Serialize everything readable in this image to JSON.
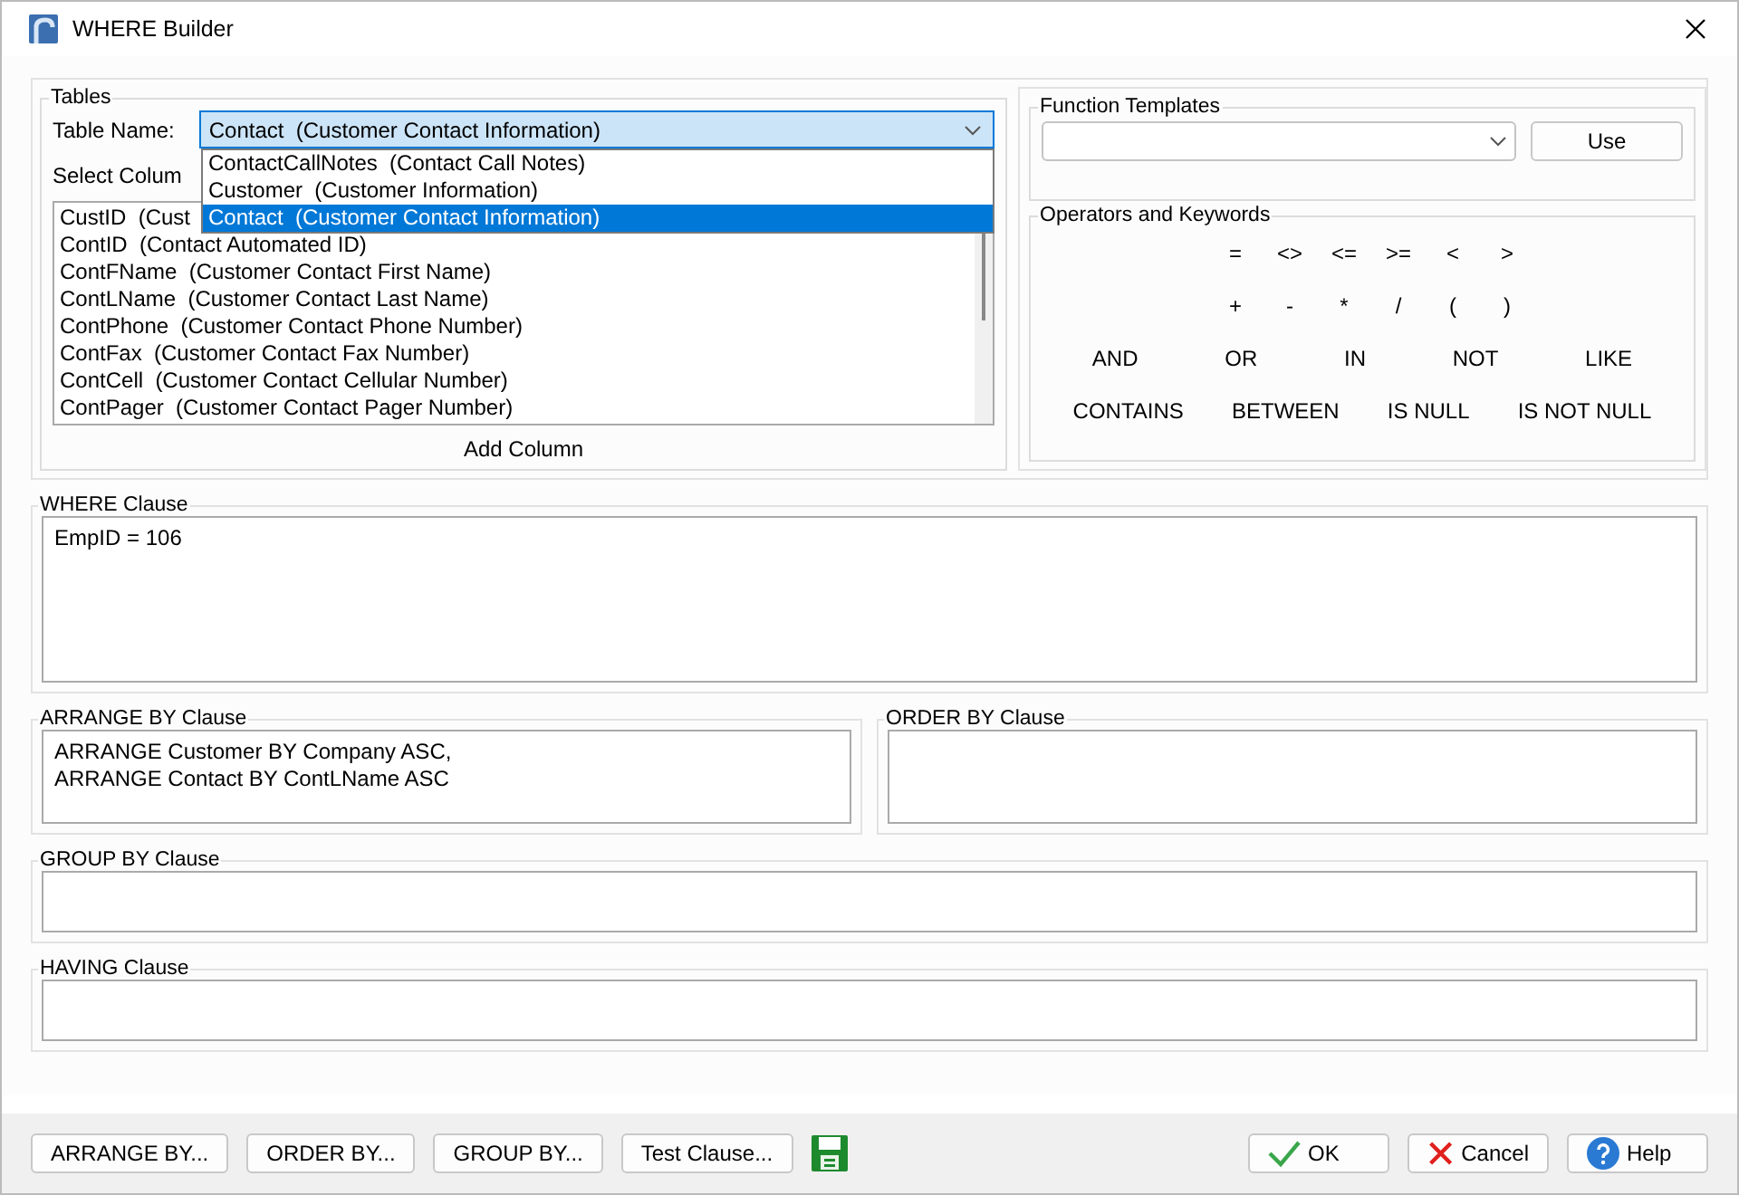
{
  "window": {
    "title": "WHERE Builder"
  },
  "tables": {
    "title": "Tables",
    "table_name_label": "Table Name:",
    "table_name": "Contact  (Customer Contact Information)",
    "dropdown_options": [
      {
        "label": "ContactCallNotes  (Contact Call Notes)",
        "selected": false
      },
      {
        "label": "Customer  (Customer Information)",
        "selected": false
      },
      {
        "label": "Contact  (Customer Contact Information)",
        "selected": true
      }
    ],
    "columns_label": "Select Colum",
    "columns": [
      "CustID  (Cust",
      "ContID  (Contact Automated ID)",
      "ContFName  (Customer Contact First Name)",
      "ContLName  (Customer Contact Last Name)",
      "ContPhone  (Customer Contact Phone Number)",
      "ContFax  (Customer Contact Fax Number)",
      "ContCell  (Customer Contact Cellular Number)",
      "ContPager  (Customer Contact Pager Number)"
    ],
    "add_column": "Add Column"
  },
  "function_templates": {
    "title": "Function Templates",
    "use_button": "Use"
  },
  "operators": {
    "title": "Operators and Keywords",
    "rows": [
      {
        "kind": "symbols",
        "items": [
          "=",
          "<>",
          "<=",
          ">=",
          "<",
          ">"
        ]
      },
      {
        "kind": "symbols",
        "items": [
          "+",
          "-",
          "*",
          "/",
          "(",
          ")"
        ]
      },
      {
        "kind": "keywords",
        "items": [
          "AND",
          "OR",
          "IN",
          "NOT",
          "LIKE"
        ]
      },
      {
        "kind": "keywords",
        "items": [
          "CONTAINS",
          "BETWEEN",
          "IS NULL",
          "IS NOT NULL"
        ]
      }
    ]
  },
  "where_clause": {
    "title": "WHERE Clause",
    "value": "EmpID  = 106"
  },
  "arrange_by_clause": {
    "title": "ARRANGE BY Clause",
    "value": "ARRANGE Customer BY Company ASC,\nARRANGE Contact BY ContLName ASC"
  },
  "order_by_clause": {
    "title": "ORDER BY Clause"
  },
  "group_by_clause": {
    "title": "GROUP BY Clause"
  },
  "having_clause": {
    "title": "HAVING Clause"
  },
  "buttons_left": [
    "ARRANGE BY...",
    "ORDER BY...",
    "GROUP BY...",
    "Test Clause..."
  ],
  "buttons_right": [
    {
      "label": "OK",
      "kind": "ok"
    },
    {
      "label": "Cancel",
      "kind": "cancel"
    },
    {
      "label": "Help",
      "kind": "help"
    }
  ]
}
